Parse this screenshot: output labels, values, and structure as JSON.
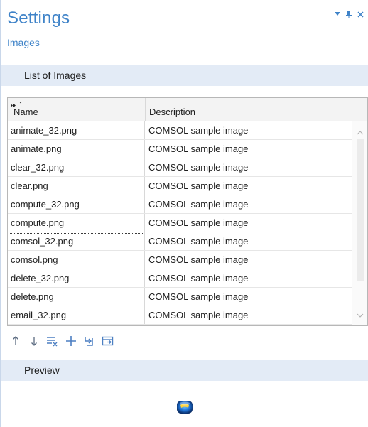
{
  "header": {
    "title": "Settings",
    "subtitle": "Images"
  },
  "list_section": {
    "title": "List of Images",
    "columns": [
      "Name",
      "Description"
    ],
    "rows": [
      {
        "name": "animate_32.png",
        "description": "COMSOL sample image"
      },
      {
        "name": "animate.png",
        "description": "COMSOL sample image"
      },
      {
        "name": "clear_32.png",
        "description": "COMSOL sample image"
      },
      {
        "name": "clear.png",
        "description": "COMSOL sample image"
      },
      {
        "name": "compute_32.png",
        "description": "COMSOL sample image"
      },
      {
        "name": "compute.png",
        "description": "COMSOL sample image"
      },
      {
        "name": "comsol_32.png",
        "description": "COMSOL sample image"
      },
      {
        "name": "comsol.png",
        "description": "COMSOL sample image"
      },
      {
        "name": "delete_32.png",
        "description": "COMSOL sample image"
      },
      {
        "name": "delete.png",
        "description": "COMSOL sample image"
      },
      {
        "name": "email_32.png",
        "description": "COMSOL sample image"
      }
    ],
    "selected_row": 6
  },
  "toolbar": {
    "buttons": [
      {
        "name": "move-up",
        "icon": "arrow-up-icon"
      },
      {
        "name": "move-down",
        "icon": "arrow-down-icon"
      },
      {
        "name": "clear-table",
        "icon": "clear-list-icon"
      },
      {
        "name": "add",
        "icon": "plus-icon"
      },
      {
        "name": "load-from-file",
        "icon": "refresh-import-icon"
      },
      {
        "name": "save-to-file",
        "icon": "export-icon"
      }
    ]
  },
  "preview_section": {
    "title": "Preview",
    "image": "comsol-logo-icon"
  },
  "colors": {
    "accent": "#3f83c8",
    "section_bg": "#e3ebf6"
  }
}
